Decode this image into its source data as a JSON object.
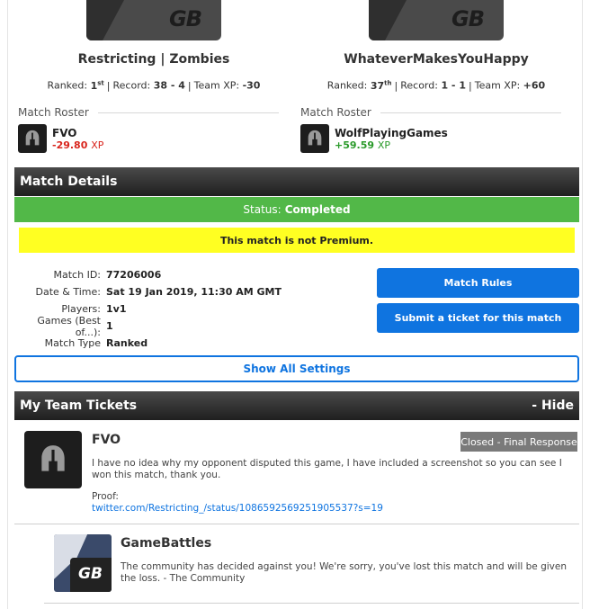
{
  "teams": [
    {
      "name": "Restricting | Zombies",
      "logo_text": "GB",
      "ranked_label": "Ranked:",
      "rank_num": "1",
      "rank_suffix": "st",
      "record_label": "Record:",
      "record": "38 - 4",
      "xp_label": "Team XP:",
      "xp": "-30"
    },
    {
      "name": "WhateverMakesYouHappy",
      "logo_text": "GB",
      "ranked_label": "Ranked:",
      "rank_num": "37",
      "rank_suffix": "th",
      "record_label": "Record:",
      "record": "1 - 1",
      "xp_label": "Team XP:",
      "xp": "+60"
    }
  ],
  "rosters": [
    {
      "title": "Match Roster",
      "player": "FVO",
      "xp": "-29.80",
      "xp_unit": "XP"
    },
    {
      "title": "Match Roster",
      "player": "WolfPlayingGames",
      "xp": "+59.59",
      "xp_unit": "XP"
    }
  ],
  "match_details": {
    "header": "Match Details",
    "status_label": "Status:",
    "status_value": "Completed",
    "premium_notice": "This match is not Premium.",
    "rows": [
      {
        "label": "Match ID:",
        "value": "77206006"
      },
      {
        "label": "Date & Time:",
        "value": "Sat 19 Jan 2019, 11:30 AM GMT"
      },
      {
        "label": "Players:",
        "value": "1v1"
      },
      {
        "label": "Games (Best of...):",
        "value": "1"
      },
      {
        "label": "Match Type",
        "value": "Ranked"
      }
    ],
    "rules_button": "Match Rules",
    "ticket_button": "Submit a ticket for this match",
    "show_settings_button": "Show All Settings"
  },
  "tickets_section": {
    "header": "My Team Tickets",
    "hide_label": "- Hide",
    "tickets": [
      {
        "author": "FVO",
        "badge": "Closed - Final Response",
        "body": "I have no idea why my opponent disputed this game, I have included a screenshot so you can see I won this match, thank you.",
        "proof_label": "Proof:",
        "proof_link": "twitter.com/Restricting_/status/1086592569251905537?s=19"
      },
      {
        "author": "GameBattles",
        "avatar_text": "GB",
        "body": "The community has decided against you! We're sorry, you've lost this match and will be given the loss. - The Community"
      }
    ]
  },
  "colors": {
    "status_green": "#52b848",
    "premium_yellow": "#ffff22",
    "button_blue": "#0f74e0",
    "xp_negative": "#d9251d",
    "xp_positive": "#2a9a2a",
    "badge_gray": "#7a7a7a"
  },
  "icons": {
    "player_avatar": "spartan-helmet-icon",
    "gamebattles_avatar": "gamebattles-logo-icon"
  }
}
